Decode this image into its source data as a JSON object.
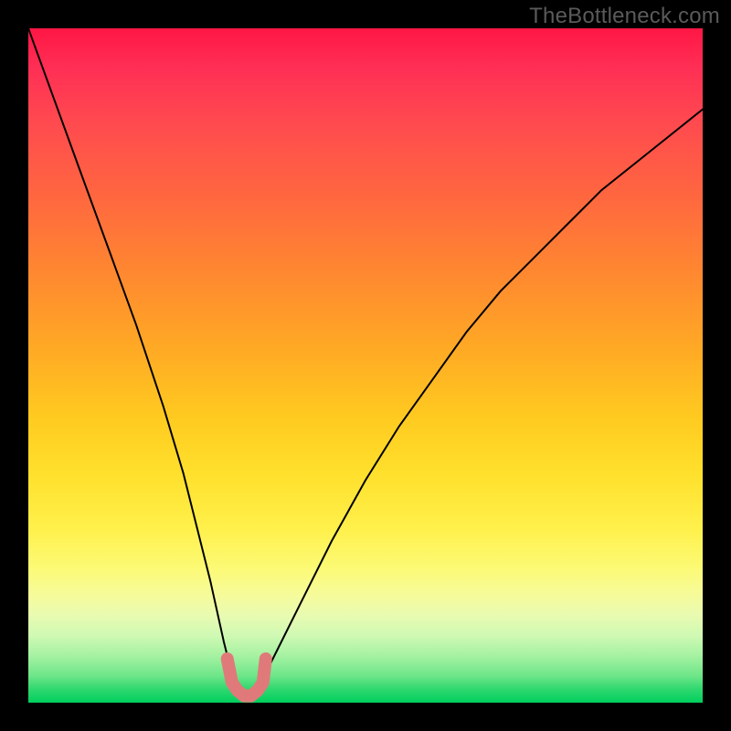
{
  "watermark": "TheBottleneck.com",
  "chart_data": {
    "type": "line",
    "title": "",
    "xlabel": "",
    "ylabel": "",
    "xlim": [
      0,
      100
    ],
    "ylim": [
      0,
      100
    ],
    "grid": false,
    "series": [
      {
        "name": "bottleneck-curve",
        "x": [
          0,
          4,
          8,
          12,
          16,
          20,
          23,
          25,
          27,
          29,
          30,
          31,
          32,
          33,
          34,
          35,
          37,
          40,
          45,
          50,
          55,
          60,
          65,
          70,
          75,
          80,
          85,
          90,
          95,
          100
        ],
        "y": [
          100,
          89,
          78,
          67,
          56,
          44,
          34,
          26,
          18,
          9,
          5,
          2,
          1,
          1,
          2,
          4,
          8,
          14,
          24,
          33,
          41,
          48,
          55,
          61,
          66,
          71,
          76,
          80,
          84,
          88
        ]
      }
    ],
    "highlight": {
      "name": "optimal-range",
      "x": [
        29.5,
        30.2,
        31,
        32,
        33,
        34,
        34.8,
        35.2
      ],
      "y": [
        6.5,
        3,
        1.8,
        1,
        1,
        1.8,
        3,
        6.5
      ]
    },
    "colors": {
      "curve": "#000000",
      "highlight": "#e07a7a",
      "gradient_top": "#ff1744",
      "gradient_bottom": "#00cf5e"
    }
  }
}
